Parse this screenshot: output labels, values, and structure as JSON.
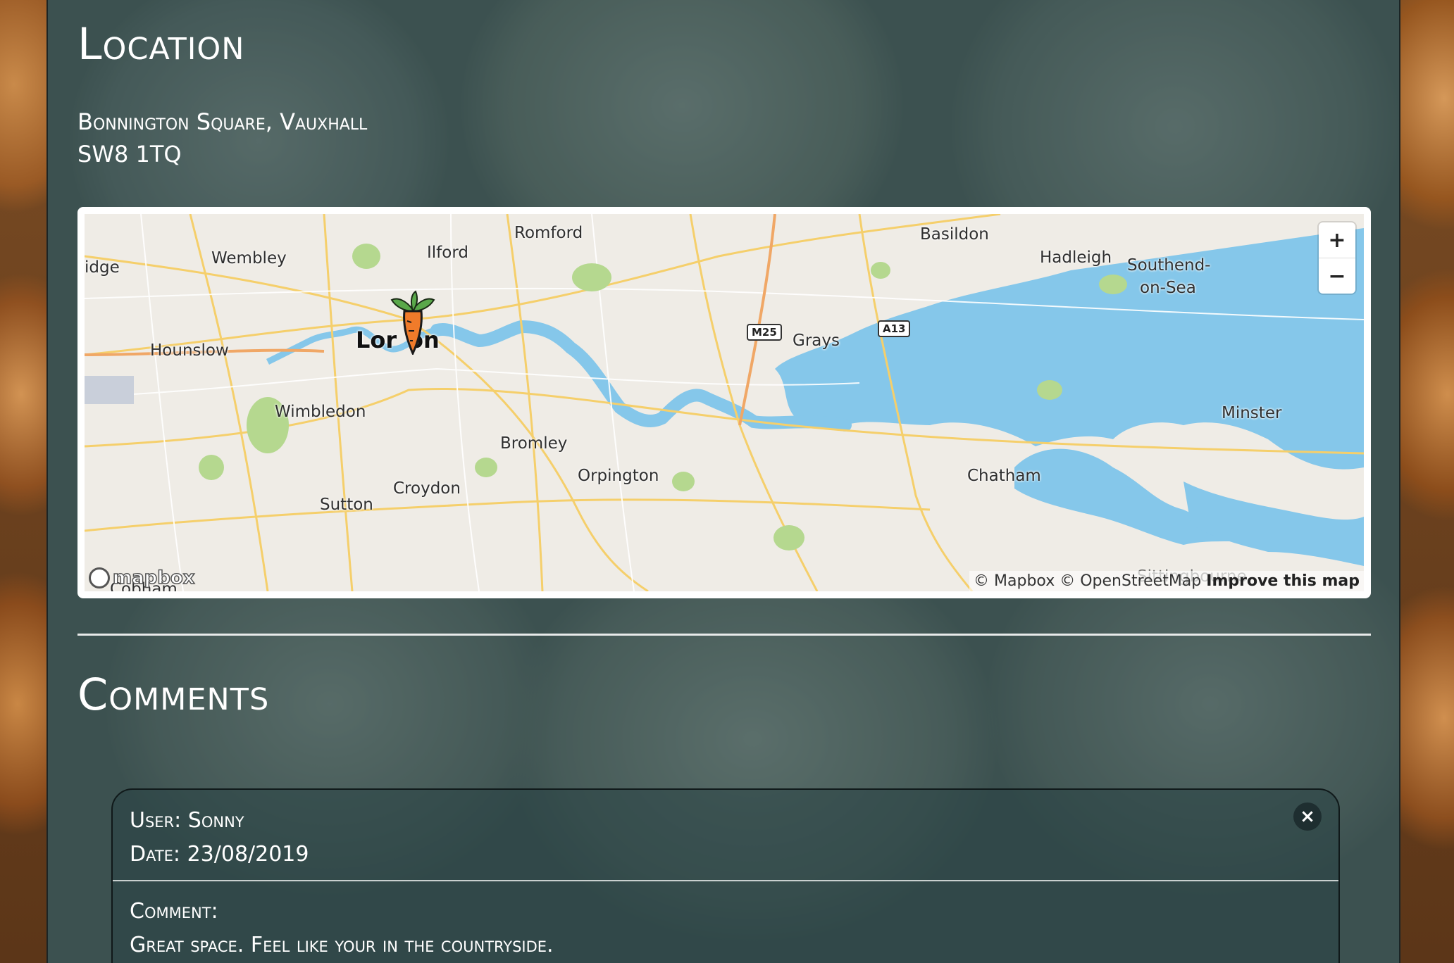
{
  "location": {
    "heading": "Location",
    "address_line1": "Bonnington Square, Vauxhall",
    "address_line2": "SW8 1TQ"
  },
  "map": {
    "places": {
      "romford": "Romford",
      "basildon": "Basildon",
      "ilford": "Ilford",
      "wembley": "Wembley",
      "hadleigh": "Hadleigh",
      "southend": "Southend-",
      "southend2": "on-Sea",
      "uxbridge": "idge",
      "london_a": "Lor",
      "london_b": "on",
      "hounslow": "Hounslow",
      "grays": "Grays",
      "wimbledon": "Wimbledon",
      "bromley": "Bromley",
      "minster": "Minster",
      "orpington": "Orpington",
      "chatham": "Chatham",
      "croydon": "Croydon",
      "sutton": "Sutton",
      "cobham": "Cobham",
      "sittingbourne": "Sittingbourne"
    },
    "shields": {
      "m25": "M25",
      "a13": "A13"
    },
    "zoom_in": "+",
    "zoom_out": "−",
    "logo": "mapbox",
    "attribution": "© Mapbox © OpenStreetMap",
    "improve": "Improve this map",
    "marker": "carrot-marker",
    "colors": {
      "water": "#85c7ea",
      "land": "#efece6",
      "park": "#b5d88f",
      "road": "#f5cf6b"
    }
  },
  "comments": {
    "heading": "Comments",
    "items": [
      {
        "user_label": "User: Sonny",
        "date_label": "Date: 23/08/2019",
        "comment_label": "Comment:",
        "comment_text": "Great space. Feel like your in the countryside.",
        "close": "×"
      }
    ]
  }
}
